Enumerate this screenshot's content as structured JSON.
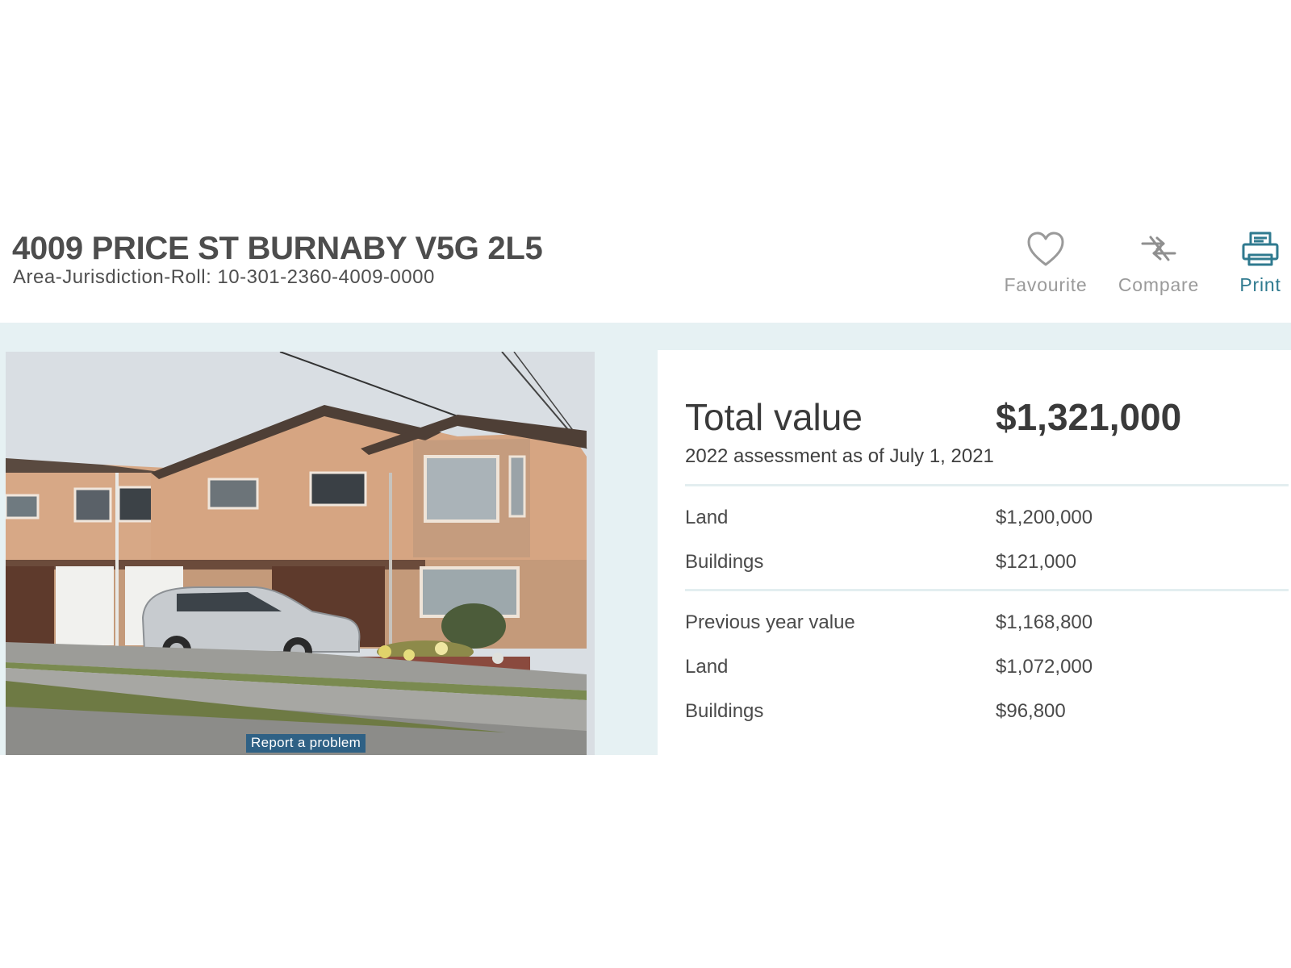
{
  "header": {
    "address": "4009 PRICE ST BURNABY V5G 2L5",
    "roll_label": "Area-Jurisdiction-Roll:",
    "roll_value": "10-301-2360-4009-0000"
  },
  "actions": {
    "favourite": {
      "label": "Favourite",
      "icon": "heart-icon"
    },
    "compare": {
      "label": "Compare",
      "icon": "compare-arrows-icon"
    },
    "print": {
      "label": "Print",
      "icon": "printer-icon"
    }
  },
  "photo": {
    "report_label": "Report a problem"
  },
  "values": {
    "total_label": "Total value",
    "total_value": "$1,321,000",
    "assessment_note": "2022 assessment as of July 1, 2021",
    "current": [
      {
        "label": "Land",
        "value": "$1,200,000"
      },
      {
        "label": "Buildings",
        "value": "$121,000"
      }
    ],
    "previous_label": "Previous year value",
    "previous_value": "$1,168,800",
    "previous": [
      {
        "label": "Land",
        "value": "$1,072,000"
      },
      {
        "label": "Buildings",
        "value": "$96,800"
      }
    ]
  },
  "colors": {
    "band": "#e6f1f3",
    "accent": "#2f7a8f",
    "muted_icon": "#9a9a9a",
    "report_button": "#2f6185"
  }
}
